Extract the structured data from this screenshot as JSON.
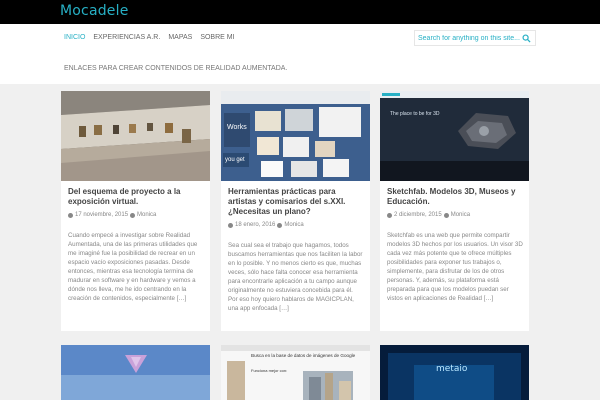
{
  "site": {
    "title": "Mocadele",
    "description": "ENLACES PARA CREAR CONTENIDOS DE REALIDAD AUMENTADA."
  },
  "nav": {
    "items": [
      "INICIO",
      "EXPERIENCIAS A.R.",
      "MAPAS",
      "SOBRE MI"
    ]
  },
  "search": {
    "placeholder": "Search for anything on this site..."
  },
  "posts": [
    {
      "title": "Del esquema de proyecto a la exposición virtual.",
      "date": "17 noviembre, 2015",
      "author": "Monica",
      "excerpt": "Cuando empecé a investigar sobre Realidad Aumentada, una de las primeras utilidades que me imaginé fue la posibilidad de recrear en un espacio vacío exposiciones pasadas. Desde entonces, mientras esa tecnología termina de madurar en software y en hardware y vemos a dónde nos lleva, me he ido centrando en la creación de contenidos, especialmente […]"
    },
    {
      "title": "Herramientas prácticas para artistas y comisarios del s.XXI. ¿Necesitas un plano?",
      "date": "18 enero, 2016",
      "author": "Monica",
      "excerpt": "Sea cual sea el trabajo que hagamos, todos buscamos herramientas que nos faciliten la labor en lo posible. Y no menos cierto es que, muchas veces, sólo hace falta conocer esa herramienta para encontrarle aplicación a tu campo aunque originalmente no estuviera concebida para él. Por eso hoy quiero hablaros de MAGICPLAN, una app enfocada […]",
      "image_texts": [
        "Works",
        "you get"
      ]
    },
    {
      "title": "Sketchfab. Modelos 3D, Museos y Educación.",
      "date": "2 diciembre, 2015",
      "author": "Monica",
      "excerpt": "Sketchfab es una web que permite compartir modelos 3D hechos por los usuarios. Un visor 3D cada vez más potente que te ofrece múltiples posibilidades para exponer tus trabajos o, simplemente, para disfrutar de los de otros personas. Y, además, su plataforma está preparada para que los modelos puedan ser vistos en aplicaciones de Realidad […]",
      "image_texts": [
        "The place to be for 3D"
      ]
    }
  ],
  "bottom_cards": [
    {},
    {
      "image_texts": [
        "Busca en la base de datos de imágenes de Google",
        "Funciona mejor con:"
      ]
    },
    {
      "image_texts": [
        "metaio"
      ]
    }
  ],
  "colors": {
    "accent": "#27b0c5",
    "topbar": "#000000",
    "background": "#f0f0f0"
  }
}
